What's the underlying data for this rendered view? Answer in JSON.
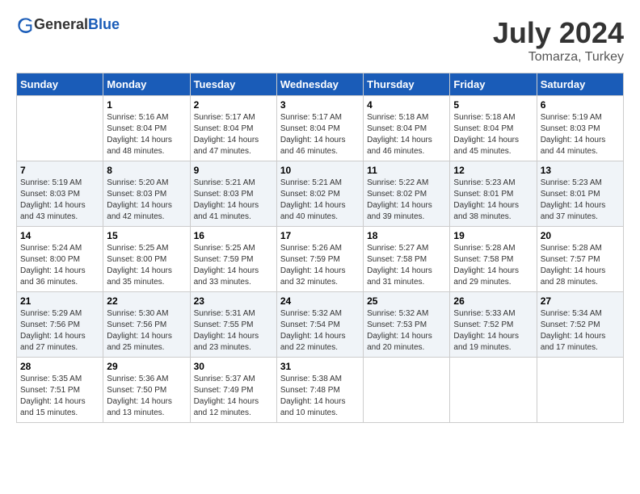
{
  "header": {
    "logo_general": "General",
    "logo_blue": "Blue",
    "title": "July 2024",
    "location": "Tomarza, Turkey"
  },
  "columns": [
    "Sunday",
    "Monday",
    "Tuesday",
    "Wednesday",
    "Thursday",
    "Friday",
    "Saturday"
  ],
  "weeks": [
    {
      "days": [
        {
          "number": "",
          "sunrise": "",
          "sunset": "",
          "daylight": "",
          "empty": true
        },
        {
          "number": "1",
          "sunrise": "Sunrise: 5:16 AM",
          "sunset": "Sunset: 8:04 PM",
          "daylight": "Daylight: 14 hours and 48 minutes."
        },
        {
          "number": "2",
          "sunrise": "Sunrise: 5:17 AM",
          "sunset": "Sunset: 8:04 PM",
          "daylight": "Daylight: 14 hours and 47 minutes."
        },
        {
          "number": "3",
          "sunrise": "Sunrise: 5:17 AM",
          "sunset": "Sunset: 8:04 PM",
          "daylight": "Daylight: 14 hours and 46 minutes."
        },
        {
          "number": "4",
          "sunrise": "Sunrise: 5:18 AM",
          "sunset": "Sunset: 8:04 PM",
          "daylight": "Daylight: 14 hours and 46 minutes."
        },
        {
          "number": "5",
          "sunrise": "Sunrise: 5:18 AM",
          "sunset": "Sunset: 8:04 PM",
          "daylight": "Daylight: 14 hours and 45 minutes."
        },
        {
          "number": "6",
          "sunrise": "Sunrise: 5:19 AM",
          "sunset": "Sunset: 8:03 PM",
          "daylight": "Daylight: 14 hours and 44 minutes."
        }
      ]
    },
    {
      "days": [
        {
          "number": "7",
          "sunrise": "Sunrise: 5:19 AM",
          "sunset": "Sunset: 8:03 PM",
          "daylight": "Daylight: 14 hours and 43 minutes."
        },
        {
          "number": "8",
          "sunrise": "Sunrise: 5:20 AM",
          "sunset": "Sunset: 8:03 PM",
          "daylight": "Daylight: 14 hours and 42 minutes."
        },
        {
          "number": "9",
          "sunrise": "Sunrise: 5:21 AM",
          "sunset": "Sunset: 8:03 PM",
          "daylight": "Daylight: 14 hours and 41 minutes."
        },
        {
          "number": "10",
          "sunrise": "Sunrise: 5:21 AM",
          "sunset": "Sunset: 8:02 PM",
          "daylight": "Daylight: 14 hours and 40 minutes."
        },
        {
          "number": "11",
          "sunrise": "Sunrise: 5:22 AM",
          "sunset": "Sunset: 8:02 PM",
          "daylight": "Daylight: 14 hours and 39 minutes."
        },
        {
          "number": "12",
          "sunrise": "Sunrise: 5:23 AM",
          "sunset": "Sunset: 8:01 PM",
          "daylight": "Daylight: 14 hours and 38 minutes."
        },
        {
          "number": "13",
          "sunrise": "Sunrise: 5:23 AM",
          "sunset": "Sunset: 8:01 PM",
          "daylight": "Daylight: 14 hours and 37 minutes."
        }
      ]
    },
    {
      "days": [
        {
          "number": "14",
          "sunrise": "Sunrise: 5:24 AM",
          "sunset": "Sunset: 8:00 PM",
          "daylight": "Daylight: 14 hours and 36 minutes."
        },
        {
          "number": "15",
          "sunrise": "Sunrise: 5:25 AM",
          "sunset": "Sunset: 8:00 PM",
          "daylight": "Daylight: 14 hours and 35 minutes."
        },
        {
          "number": "16",
          "sunrise": "Sunrise: 5:25 AM",
          "sunset": "Sunset: 7:59 PM",
          "daylight": "Daylight: 14 hours and 33 minutes."
        },
        {
          "number": "17",
          "sunrise": "Sunrise: 5:26 AM",
          "sunset": "Sunset: 7:59 PM",
          "daylight": "Daylight: 14 hours and 32 minutes."
        },
        {
          "number": "18",
          "sunrise": "Sunrise: 5:27 AM",
          "sunset": "Sunset: 7:58 PM",
          "daylight": "Daylight: 14 hours and 31 minutes."
        },
        {
          "number": "19",
          "sunrise": "Sunrise: 5:28 AM",
          "sunset": "Sunset: 7:58 PM",
          "daylight": "Daylight: 14 hours and 29 minutes."
        },
        {
          "number": "20",
          "sunrise": "Sunrise: 5:28 AM",
          "sunset": "Sunset: 7:57 PM",
          "daylight": "Daylight: 14 hours and 28 minutes."
        }
      ]
    },
    {
      "days": [
        {
          "number": "21",
          "sunrise": "Sunrise: 5:29 AM",
          "sunset": "Sunset: 7:56 PM",
          "daylight": "Daylight: 14 hours and 27 minutes."
        },
        {
          "number": "22",
          "sunrise": "Sunrise: 5:30 AM",
          "sunset": "Sunset: 7:56 PM",
          "daylight": "Daylight: 14 hours and 25 minutes."
        },
        {
          "number": "23",
          "sunrise": "Sunrise: 5:31 AM",
          "sunset": "Sunset: 7:55 PM",
          "daylight": "Daylight: 14 hours and 23 minutes."
        },
        {
          "number": "24",
          "sunrise": "Sunrise: 5:32 AM",
          "sunset": "Sunset: 7:54 PM",
          "daylight": "Daylight: 14 hours and 22 minutes."
        },
        {
          "number": "25",
          "sunrise": "Sunrise: 5:32 AM",
          "sunset": "Sunset: 7:53 PM",
          "daylight": "Daylight: 14 hours and 20 minutes."
        },
        {
          "number": "26",
          "sunrise": "Sunrise: 5:33 AM",
          "sunset": "Sunset: 7:52 PM",
          "daylight": "Daylight: 14 hours and 19 minutes."
        },
        {
          "number": "27",
          "sunrise": "Sunrise: 5:34 AM",
          "sunset": "Sunset: 7:52 PM",
          "daylight": "Daylight: 14 hours and 17 minutes."
        }
      ]
    },
    {
      "days": [
        {
          "number": "28",
          "sunrise": "Sunrise: 5:35 AM",
          "sunset": "Sunset: 7:51 PM",
          "daylight": "Daylight: 14 hours and 15 minutes."
        },
        {
          "number": "29",
          "sunrise": "Sunrise: 5:36 AM",
          "sunset": "Sunset: 7:50 PM",
          "daylight": "Daylight: 14 hours and 13 minutes."
        },
        {
          "number": "30",
          "sunrise": "Sunrise: 5:37 AM",
          "sunset": "Sunset: 7:49 PM",
          "daylight": "Daylight: 14 hours and 12 minutes."
        },
        {
          "number": "31",
          "sunrise": "Sunrise: 5:38 AM",
          "sunset": "Sunset: 7:48 PM",
          "daylight": "Daylight: 14 hours and 10 minutes."
        },
        {
          "number": "",
          "sunrise": "",
          "sunset": "",
          "daylight": "",
          "empty": true
        },
        {
          "number": "",
          "sunrise": "",
          "sunset": "",
          "daylight": "",
          "empty": true
        },
        {
          "number": "",
          "sunrise": "",
          "sunset": "",
          "daylight": "",
          "empty": true
        }
      ]
    }
  ]
}
